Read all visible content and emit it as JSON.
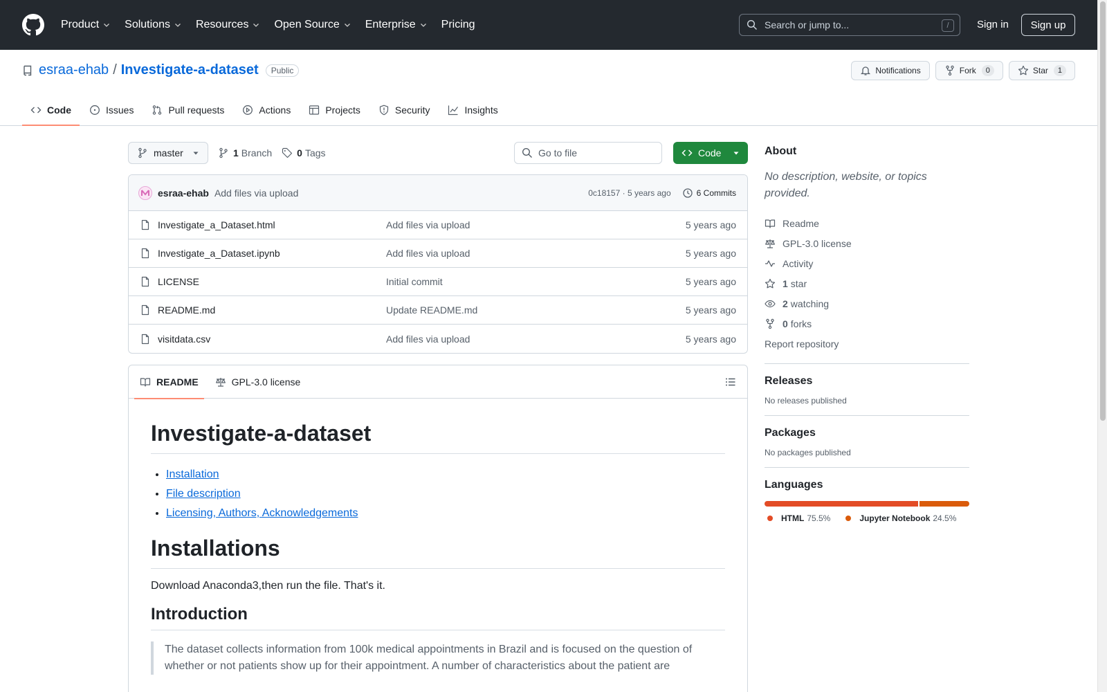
{
  "header": {
    "nav": [
      "Product",
      "Solutions",
      "Resources",
      "Open Source",
      "Enterprise",
      "Pricing"
    ],
    "search_placeholder": "Search or jump to...",
    "search_shortcut": "/",
    "sign_in": "Sign in",
    "sign_up": "Sign up"
  },
  "repo": {
    "owner": "esraa-ehab",
    "separator": "/",
    "name": "Investigate-a-dataset",
    "visibility": "Public",
    "notifications_label": "Notifications",
    "fork_label": "Fork",
    "fork_count": "0",
    "star_label": "Star",
    "star_count": "1",
    "tabs": [
      "Code",
      "Issues",
      "Pull requests",
      "Actions",
      "Projects",
      "Security",
      "Insights"
    ]
  },
  "toolbar": {
    "branch": "master",
    "branch_count": "1",
    "branch_label": "Branch",
    "tag_count": "0",
    "tag_label": "Tags",
    "goto_placeholder": "Go to file",
    "code_label": "Code"
  },
  "commit": {
    "author": "esraa-ehab",
    "message": "Add files via upload",
    "hash_date": "0c18157 · 5 years ago",
    "commits": "6 Commits"
  },
  "files": [
    {
      "name": "Investigate_a_Dataset.html",
      "message": "Add files via upload",
      "date": "5 years ago"
    },
    {
      "name": "Investigate_a_Dataset.ipynb",
      "message": "Add files via upload",
      "date": "5 years ago"
    },
    {
      "name": "LICENSE",
      "message": "Initial commit",
      "date": "5 years ago"
    },
    {
      "name": "README.md",
      "message": "Update README.md",
      "date": "5 years ago"
    },
    {
      "name": "visitdata.csv",
      "message": "Add files via upload",
      "date": "5 years ago"
    }
  ],
  "readme": {
    "tab_readme": "README",
    "tab_license": "GPL-3.0 license",
    "title": "Investigate-a-dataset",
    "toc": [
      "Installation",
      "File description",
      "Licensing, Authors, Acknowledgements"
    ],
    "h_install": "Installations",
    "install_text": "Download Anaconda3,then run the file. That's it.",
    "h_intro": "Introduction",
    "intro_text": "The dataset collects information from 100k medical appointments in Brazil and is focused on the question of whether or not patients show up for their appointment. A number of characteristics about the patient are"
  },
  "sidebar": {
    "about_title": "About",
    "about_desc": "No description, website, or topics provided.",
    "links": {
      "readme": "Readme",
      "license": "GPL-3.0 license",
      "activity": "Activity",
      "stars_count": "1",
      "stars_label": "star",
      "watching_count": "2",
      "watching_label": "watching",
      "forks_count": "0",
      "forks_label": "forks",
      "report": "Report repository"
    },
    "releases_title": "Releases",
    "releases_text": "No releases published",
    "packages_title": "Packages",
    "packages_text": "No packages published",
    "languages_title": "Languages",
    "languages": [
      {
        "name": "HTML",
        "percent": "75.5%",
        "value": 75.5,
        "color": "#e34c26"
      },
      {
        "name": "Jupyter Notebook",
        "percent": "24.5%",
        "value": 24.5,
        "color": "#da5b0b"
      }
    ]
  },
  "colors": {
    "header_bg": "#24292f",
    "link": "#0969da",
    "primary_button": "#1f883d",
    "tab_underline": "#fd8c73"
  }
}
